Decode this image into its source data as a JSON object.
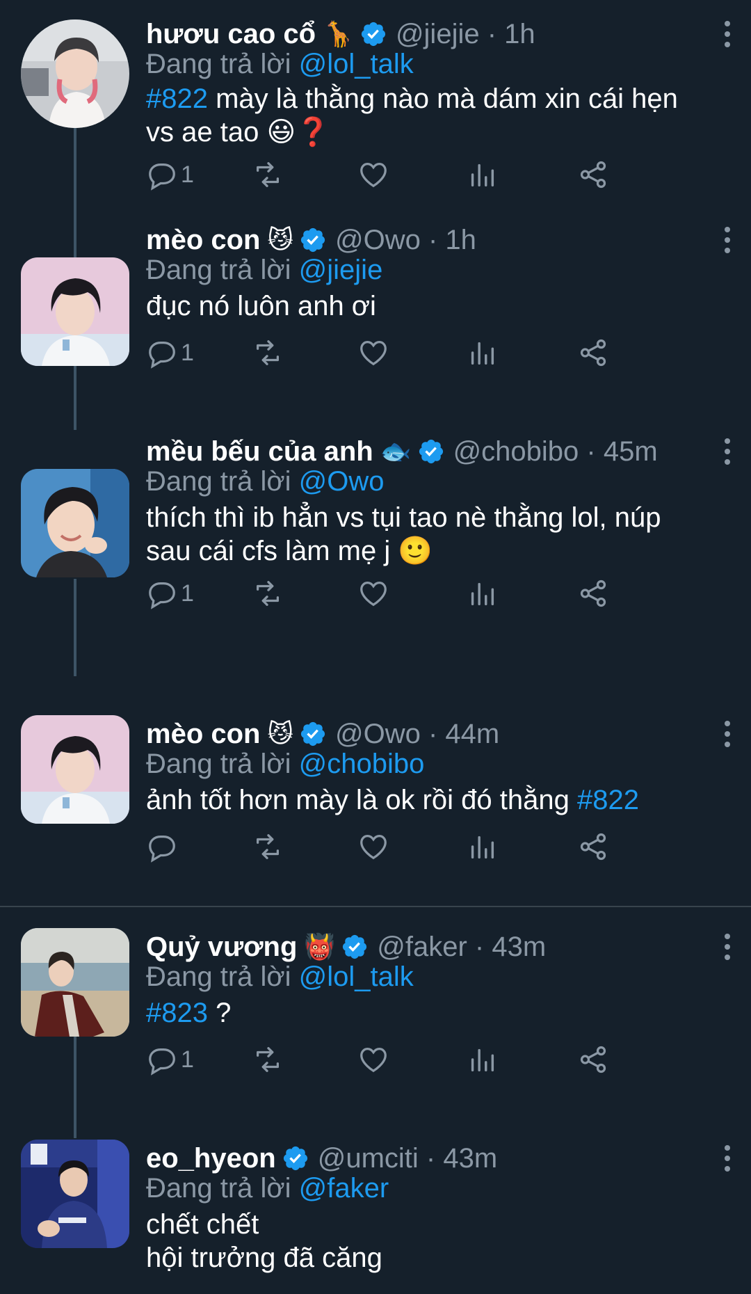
{
  "colors": {
    "background": "#15202b",
    "accent": "#1d9bf0",
    "muted": "#8b98a5",
    "thread_line": "#3d5466"
  },
  "replying_prefix": "Đang trả lời",
  "tweets": [
    {
      "name": "hươu cao cổ",
      "name_emoji": "🦒",
      "verified": true,
      "handle": "@jiejie",
      "time": "1h",
      "replying_to": "@lol_talk",
      "text_hashtag": "#822",
      "text_rest": " mày là thằng nào mà dám xin cái hẹn",
      "text_line2": "vs ae tao 😃❓",
      "reply_count": "1",
      "avatar_icon": "person-photo"
    },
    {
      "name": "mèo con",
      "name_emoji": "😼",
      "verified": true,
      "handle": "@Owo",
      "time": "1h",
      "replying_to": "@jiejie",
      "text": "đục nó luôn anh ơi",
      "reply_count": "1",
      "avatar_icon": "person-photo"
    },
    {
      "name": "mều bếu của anh",
      "name_emoji": "🐟",
      "verified": true,
      "handle": "@chobibo",
      "time": "45m",
      "replying_to": "@Owo",
      "text_line1": "thích thì ib hẳn vs tụi tao nè thằng lol, núp",
      "text_line2": "sau cái cfs làm mẹ j 🙂",
      "reply_count": "1",
      "avatar_icon": "person-photo"
    },
    {
      "name": "mèo con",
      "name_emoji": "😼",
      "verified": true,
      "handle": "@Owo",
      "time": "44m",
      "replying_to": "@chobibo",
      "text_prefix": "ảnh tốt hơn mày là ok rồi đó thằng ",
      "text_hashtag": "#822",
      "reply_count": "",
      "avatar_icon": "person-photo"
    },
    {
      "name": "Quỷ vương",
      "name_emoji": "👹",
      "verified": true,
      "handle": "@faker",
      "time": "43m",
      "replying_to": "@lol_talk",
      "text_hashtag": "#823",
      "text_rest": " ?",
      "reply_count": "1",
      "avatar_icon": "person-photo"
    },
    {
      "name": "eo_hyeon",
      "name_emoji": "",
      "verified": true,
      "handle": "@umciti",
      "time": "43m",
      "replying_to": "@faker",
      "text_line1": "chết chết",
      "text_line2": "hội trưởng đã căng",
      "avatar_icon": "person-photo"
    }
  ]
}
